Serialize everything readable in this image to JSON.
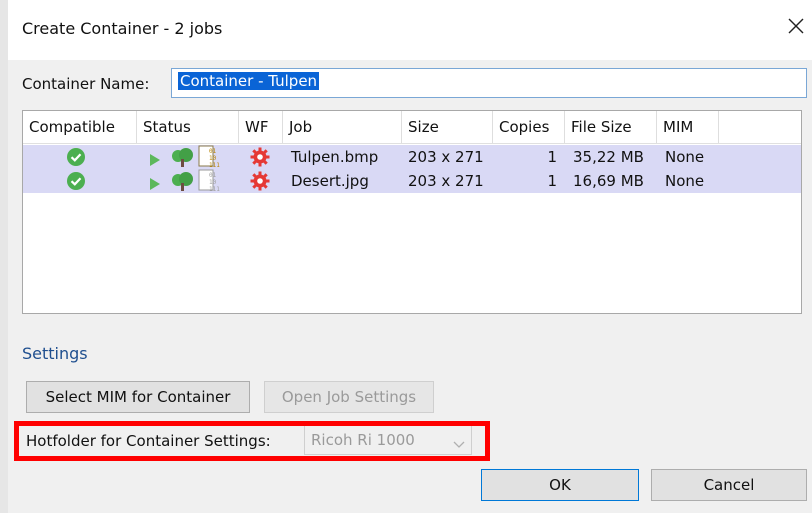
{
  "window": {
    "title": "Create Container - 2 jobs",
    "close_glyph": "✕"
  },
  "container_name": {
    "label": "Container Name:",
    "value": "Container - Tulpen"
  },
  "jobs_table": {
    "columns": [
      "Compatible",
      "Status",
      "WF",
      "Job",
      "Size",
      "Copies",
      "File Size",
      "MIM"
    ],
    "rows": [
      {
        "compatible_icon": "green-check-icon",
        "status_icons": [
          "play-icon",
          "tree-icon",
          "binary-file-icon"
        ],
        "wf_icon": "red-gear-icon",
        "job": "Tulpen.bmp",
        "size": "203 x 271",
        "copies": "1",
        "file_size": "35,22 MB",
        "mim": "None"
      },
      {
        "compatible_icon": "green-check-icon",
        "status_icons": [
          "play-icon",
          "tree-icon",
          "binary-file-icon"
        ],
        "wf_icon": "red-gear-icon",
        "job": "Desert.jpg",
        "size": "203 x 271",
        "copies": "1",
        "file_size": "16,69 MB",
        "mim": "None"
      }
    ],
    "row_highlight_color": "#d9d9f5"
  },
  "settings": {
    "title": "Settings",
    "select_mim_label": "Select MIM for Container",
    "open_job_settings_label": "Open Job Settings",
    "hotfolder_label": "Hotfolder for Container Settings:",
    "hotfolder_value": "Ricoh Ri 1000"
  },
  "buttons": {
    "ok_label": "OK",
    "cancel_label": "Cancel"
  },
  "colors": {
    "selection": "#0a64d6",
    "settings_heading": "#1f4f8f",
    "highlight_box": "#ff0000",
    "check_green": "#4caf50",
    "gear_red": "#e53935"
  }
}
